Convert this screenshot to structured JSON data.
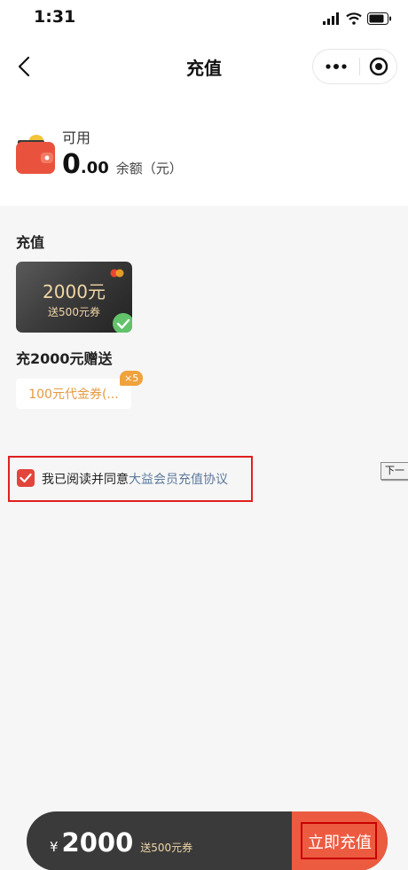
{
  "status_bar": {
    "time": "1:31"
  },
  "nav": {
    "title": "充值"
  },
  "balance": {
    "label": "可用",
    "integer": "0",
    "decimal": ".00",
    "unit": "余额（元）"
  },
  "recharge": {
    "section_title": "充值",
    "card": {
      "amount": "2000元",
      "gift": "送500元券"
    },
    "gift_title": "充2000元赠送",
    "coupon": {
      "text": "100元代金券(...",
      "badge": "×5"
    }
  },
  "agreement": {
    "text": "我已阅读并同意",
    "link": "大益会员充值协议"
  },
  "tooltip": {
    "text": "下一"
  },
  "footer": {
    "currency": "¥",
    "amount": "2000",
    "gift": "送500元券",
    "pay_label": "立即充值"
  },
  "colors": {
    "accent": "#e2453b",
    "gold": "#f0d6a8",
    "link": "#5d7a9c"
  }
}
